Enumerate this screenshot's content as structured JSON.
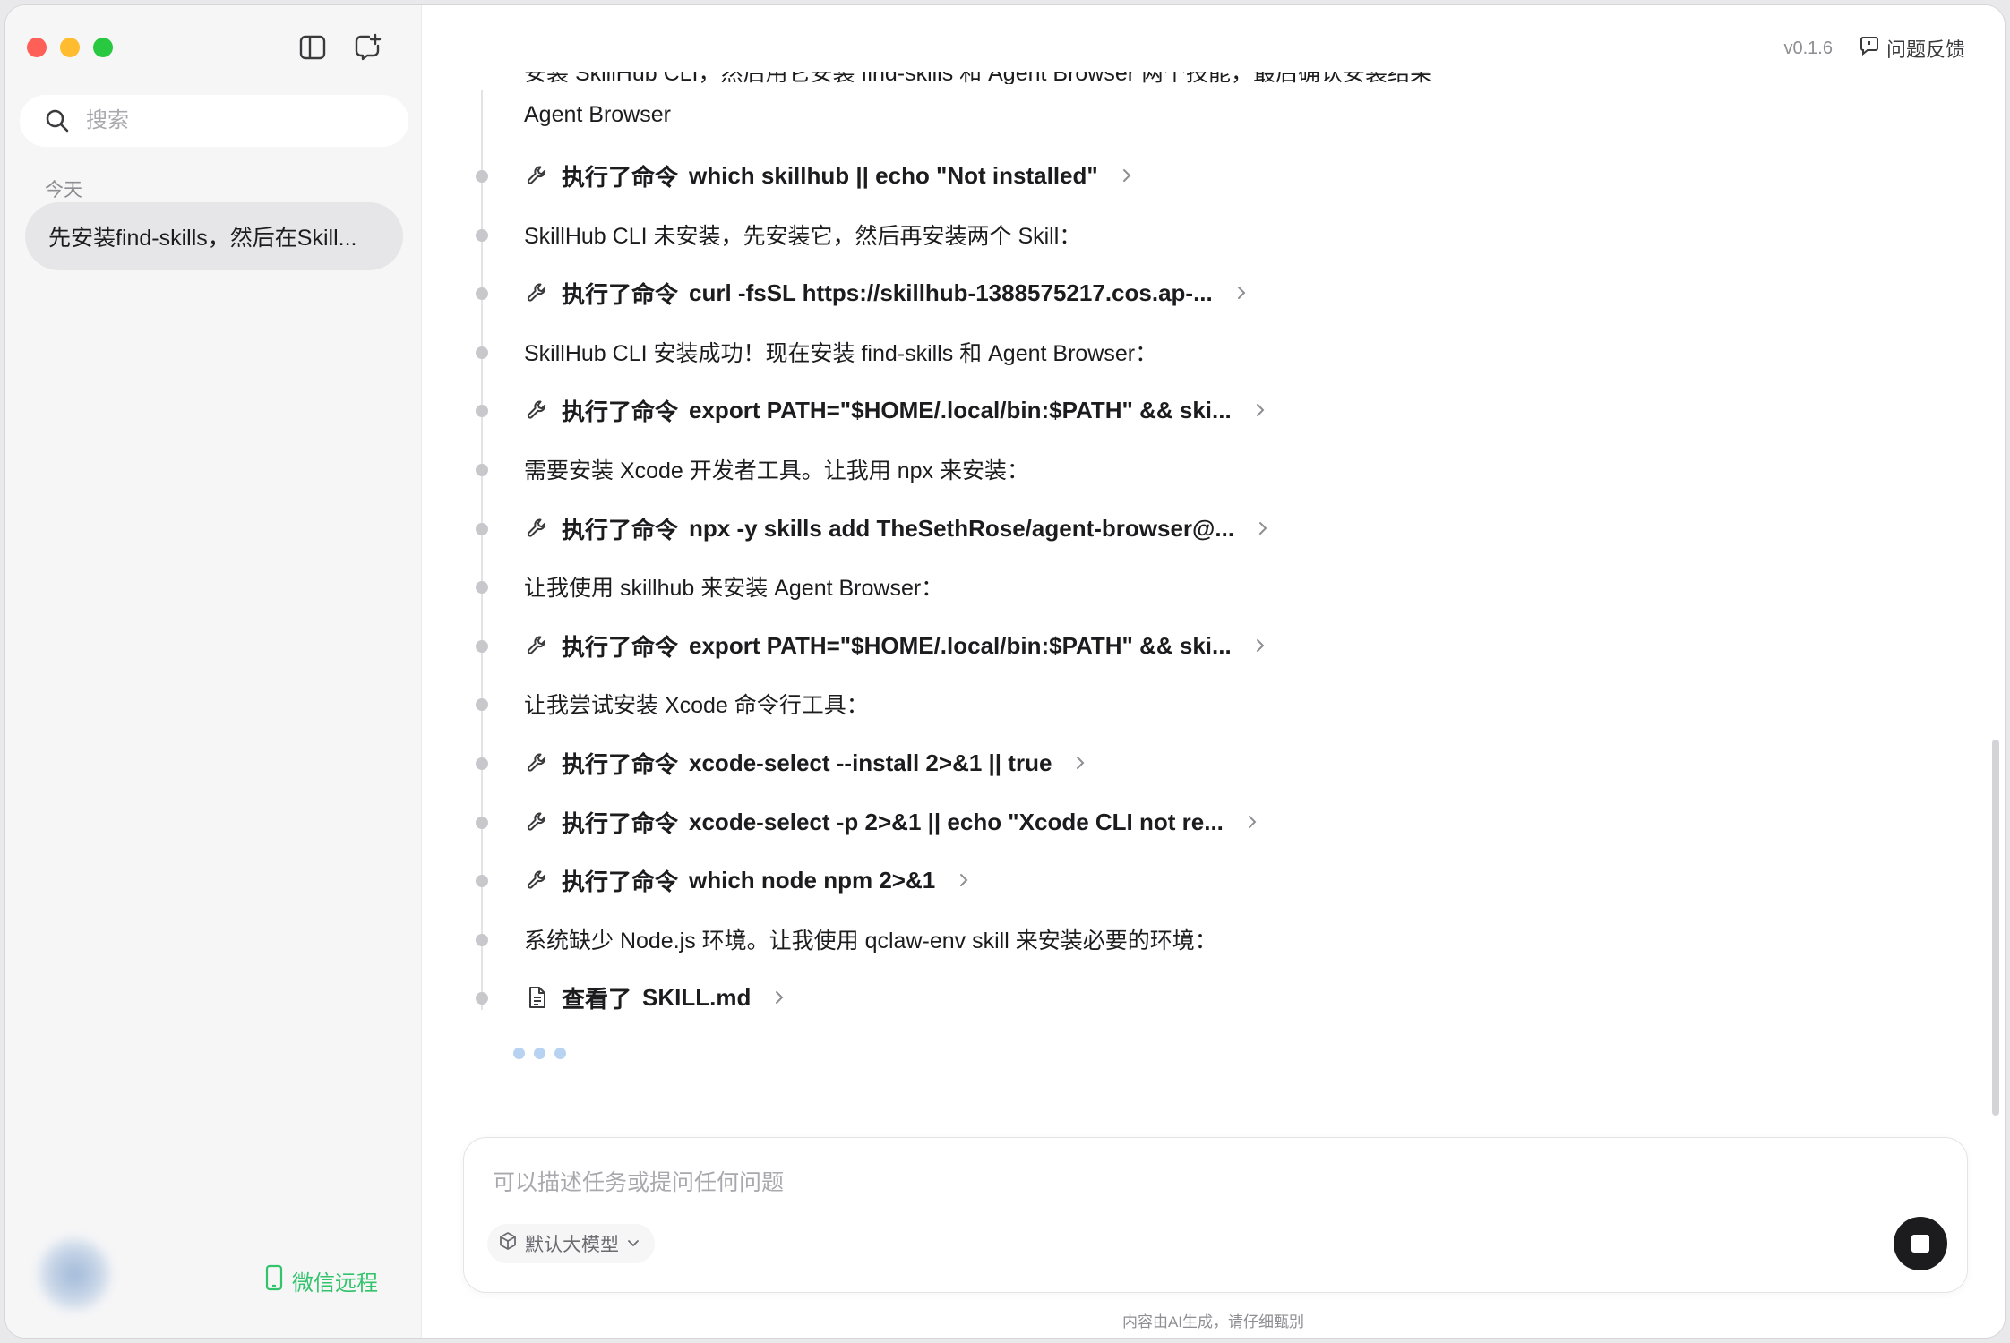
{
  "app": {
    "version": "v0.1.6",
    "feedback_label": "问题反馈"
  },
  "sidebar": {
    "search_placeholder": "搜索",
    "section_today": "今天",
    "chats": [
      {
        "title": "先安装find-skills，然后在Skill..."
      }
    ],
    "wechat_remote_label": "微信远程"
  },
  "conversation": {
    "clipped_line": "安装 SkillHub CLI，然后用它安装 find-skills 和 Agent Browser 两个技能，最后确认安装结果",
    "first_text": "Agent Browser",
    "entries": [
      {
        "type": "command",
        "label": "执行了命令",
        "text": "which skillhub || echo \"Not installed\""
      },
      {
        "type": "text",
        "text": "SkillHub CLI 未安装，先安装它，然后再安装两个 Skill："
      },
      {
        "type": "command",
        "label": "执行了命令",
        "text": "curl -fsSL https://skillhub-1388575217.cos.ap-..."
      },
      {
        "type": "text",
        "text": "SkillHub CLI 安装成功！现在安装 find-skills 和 Agent Browser："
      },
      {
        "type": "command",
        "label": "执行了命令",
        "text": "export PATH=\"$HOME/.local/bin:$PATH\" && ski..."
      },
      {
        "type": "text",
        "text": "需要安装 Xcode 开发者工具。让我用 npx 来安装："
      },
      {
        "type": "command",
        "label": "执行了命令",
        "text": "npx -y skills add TheSethRose/agent-browser@..."
      },
      {
        "type": "text",
        "text": "让我使用 skillhub 来安装 Agent Browser："
      },
      {
        "type": "command",
        "label": "执行了命令",
        "text": "export PATH=\"$HOME/.local/bin:$PATH\" && ski..."
      },
      {
        "type": "text",
        "text": "让我尝试安装 Xcode 命令行工具："
      },
      {
        "type": "command",
        "label": "执行了命令",
        "text": "xcode-select --install 2>&1 || true"
      },
      {
        "type": "command",
        "label": "执行了命令",
        "text": "xcode-select -p 2>&1 || echo \"Xcode CLI not re..."
      },
      {
        "type": "command",
        "label": "执行了命令",
        "text": "which node npm 2>&1"
      },
      {
        "type": "text",
        "text": "系统缺少 Node.js 环境。让我使用 qclaw-env skill 来安装必要的环境："
      },
      {
        "type": "file",
        "label": "查看了",
        "text": "SKILL.md"
      }
    ]
  },
  "composer": {
    "placeholder": "可以描述任务或提问任何问题",
    "model_label": "默认大模型"
  },
  "footer": {
    "disclaimer": "内容由AI生成，请仔细甄别"
  },
  "colors": {
    "accent_green": "#33c36b",
    "traffic_red": "#fe5f57",
    "traffic_yellow": "#febc2e",
    "traffic_green": "#28c840",
    "typing_dots": "#b8d2f2"
  },
  "icons": {
    "sidebar_toggle": "sidebar-toggle-icon",
    "new_chat": "new-chat-icon",
    "search": "search-icon",
    "phone": "phone-icon",
    "feedback": "feedback-icon",
    "wrench": "wrench-icon",
    "file": "file-icon",
    "chevron": "chevron-right-icon",
    "cube": "cube-icon",
    "stop": "stop-icon"
  }
}
